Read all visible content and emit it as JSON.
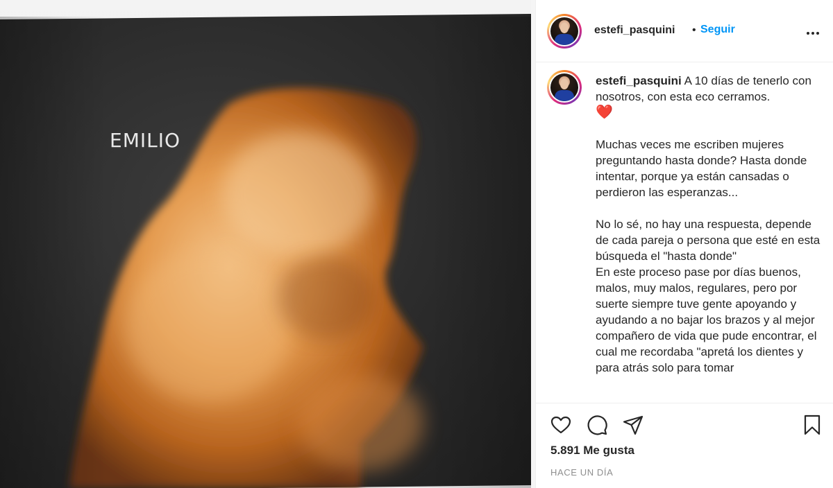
{
  "media": {
    "label": "EMILIO"
  },
  "post": {
    "username": "estefi_pasquini",
    "separator": "•",
    "follow_label": "Seguir",
    "more_icon": "more-options-icon"
  },
  "caption": {
    "username": "estefi_pasquini",
    "p1": "A 10 días de tenerlo con nosotros, con esta eco cerramos.",
    "emoji": "❤️",
    "p2": "Muchas veces me escriben mujeres preguntando hasta donde? Hasta donde intentar, porque ya están cansadas o perdieron las esperanzas...",
    "p3": "No lo sé, no hay una respuesta, depende de cada pareja o persona que esté en esta búsqueda el \"hasta donde\"",
    "p4": "En este proceso pase por días buenos, malos, muy malos, regulares, pero por suerte siempre tuve gente apoyando y ayudando a no bajar los brazos y al mejor compañero de vida que pude encontrar, el cual me recordaba \"apretá los dientes y para atrás solo para tomar"
  },
  "actions": {
    "like_icon": "heart-icon",
    "comment_icon": "comment-icon",
    "share_icon": "share-icon",
    "save_icon": "bookmark-icon",
    "likes": "5.891 Me gusta",
    "timestamp": "HACE UN DÍA"
  },
  "colors": {
    "accent": "#0095f6",
    "text": "#262626",
    "muted": "#8e8e8e",
    "border": "#efefef"
  }
}
